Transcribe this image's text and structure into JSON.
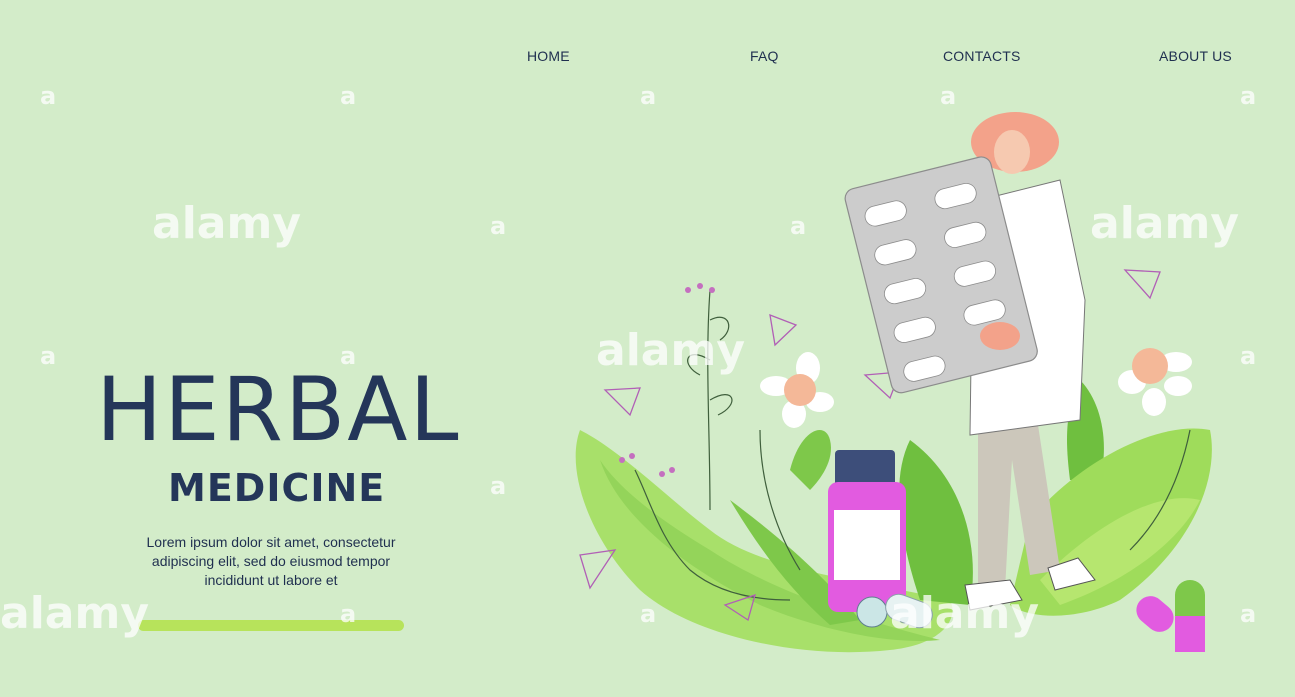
{
  "nav": {
    "items": [
      {
        "id": "home",
        "label": "HOME"
      },
      {
        "id": "faq",
        "label": "FAQ"
      },
      {
        "id": "contacts",
        "label": "CONTACTS"
      },
      {
        "id": "about",
        "label": "ABOUT US"
      }
    ]
  },
  "hero": {
    "title": "HERBAL",
    "subtitle": "MEDICINE",
    "body": "Lorem ipsum dolor sit amet, consectetur adipiscing elit, sed do eiusmod tempor incididunt ut labore et"
  },
  "watermark": {
    "word": "alamy",
    "letter": "a"
  },
  "colors": {
    "background": "#d3ecc9",
    "text": "#243659",
    "cta": "#b7e35b",
    "leaf_light": "#9fdc5b",
    "leaf_dark": "#6fbf3f",
    "bottle": "#e25be0"
  },
  "illustration": {
    "icon": "doctor-holding-pill-blister-icon"
  }
}
